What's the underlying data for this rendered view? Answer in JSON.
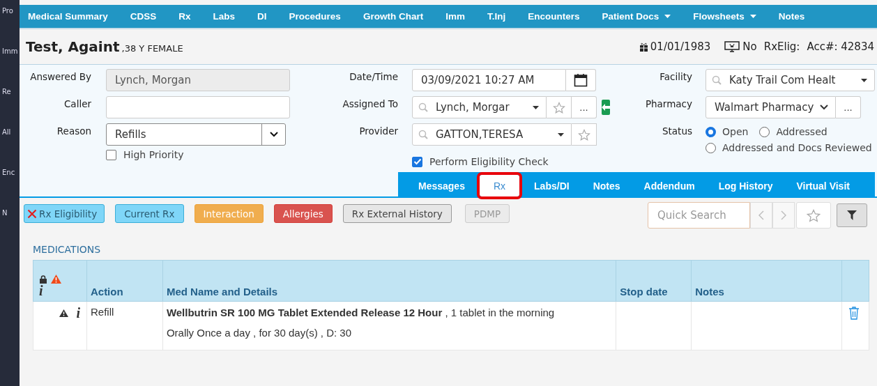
{
  "sidebar": {
    "items": [
      "Pro",
      "Imm",
      "Re",
      "All",
      "Enc",
      "N"
    ]
  },
  "nav": {
    "items": [
      {
        "label": "Medical Summary",
        "has_menu": false
      },
      {
        "label": "CDSS",
        "has_menu": false
      },
      {
        "label": "Rx",
        "has_menu": false
      },
      {
        "label": "Labs",
        "has_menu": false
      },
      {
        "label": "DI",
        "has_menu": false
      },
      {
        "label": "Procedures",
        "has_menu": false
      },
      {
        "label": "Growth Chart",
        "has_menu": false
      },
      {
        "label": "Imm",
        "has_menu": false
      },
      {
        "label": "T.Inj",
        "has_menu": false
      },
      {
        "label": "Encounters",
        "has_menu": false
      },
      {
        "label": "Patient Docs",
        "has_menu": true
      },
      {
        "label": "Flowsheets",
        "has_menu": true
      },
      {
        "label": "Notes",
        "has_menu": false
      }
    ]
  },
  "patient": {
    "name": "Test, Againt",
    "details": ",38 Y FEMALE",
    "dob": "01/01/1983",
    "portal": "No",
    "rx_elig": "RxElig:",
    "account": "Acc#: 42834"
  },
  "form": {
    "answered_by": {
      "label": "Answered By",
      "value": "Lynch, Morgan"
    },
    "caller": {
      "label": "Caller"
    },
    "reason": {
      "label": "Reason",
      "value": "Refills"
    },
    "high_priority": {
      "label": "High Priority",
      "checked": false
    },
    "date_time": {
      "label": "Date/Time",
      "value": "03/09/2021 10:27 AM"
    },
    "assigned_to": {
      "label": "Assigned To",
      "value": "Lynch, Morgar",
      "more": "..."
    },
    "provider": {
      "label": "Provider",
      "value": "GATTON,TERESA"
    },
    "eligibility_check": {
      "label": "Perform Eligibility Check",
      "checked": true
    },
    "facility": {
      "label": "Facility",
      "value": "Katy Trail Com Healt"
    },
    "pharmacy": {
      "label": "Pharmacy",
      "value": "Walmart Pharmacy",
      "more": "..."
    },
    "status": {
      "label": "Status",
      "options": [
        {
          "label": "Open",
          "selected": true
        },
        {
          "label": "Addressed",
          "selected": false
        },
        {
          "label": "Addressed and Docs Reviewed",
          "selected": false
        }
      ]
    }
  },
  "tabs": [
    {
      "label": "Messages",
      "selected": false,
      "highlighted": false
    },
    {
      "label": "Rx",
      "selected": true,
      "highlighted": true
    },
    {
      "label": "Labs/DI",
      "selected": false,
      "highlighted": false
    },
    {
      "label": "Notes",
      "selected": false,
      "highlighted": false
    },
    {
      "label": "Addendum",
      "selected": false,
      "highlighted": false
    },
    {
      "label": "Log History",
      "selected": false,
      "highlighted": false
    },
    {
      "label": "Virtual Visit",
      "selected": false,
      "highlighted": false
    }
  ],
  "toolbar": {
    "buttons": [
      {
        "label": "Rx Eligibility",
        "kind": "info",
        "failed": true,
        "disabled": false
      },
      {
        "label": "Current Rx",
        "kind": "info",
        "failed": false,
        "disabled": false
      },
      {
        "label": "Interaction",
        "kind": "warning",
        "failed": false,
        "disabled": false
      },
      {
        "label": "Allergies",
        "kind": "danger",
        "failed": false,
        "disabled": false
      },
      {
        "label": "Rx External History",
        "kind": "default",
        "failed": false,
        "disabled": false
      },
      {
        "label": "PDMP",
        "kind": "default",
        "failed": false,
        "disabled": true
      }
    ],
    "search": {
      "placeholder": "Quick Search"
    }
  },
  "medications": {
    "title": "MEDICATIONS",
    "info_glyph": "i",
    "columns": [
      "Action",
      "Med Name and Details",
      "Stop date",
      "Notes"
    ],
    "rows": [
      {
        "info": "i",
        "action": "Refill",
        "med_name": "Wellbutrin SR 100 MG Tablet Extended Release 12 Hour",
        "med_details_1": " , 1 tablet in the morning",
        "med_details_2": "Orally Once a day , for 30 day(s) , D: 30"
      }
    ]
  }
}
